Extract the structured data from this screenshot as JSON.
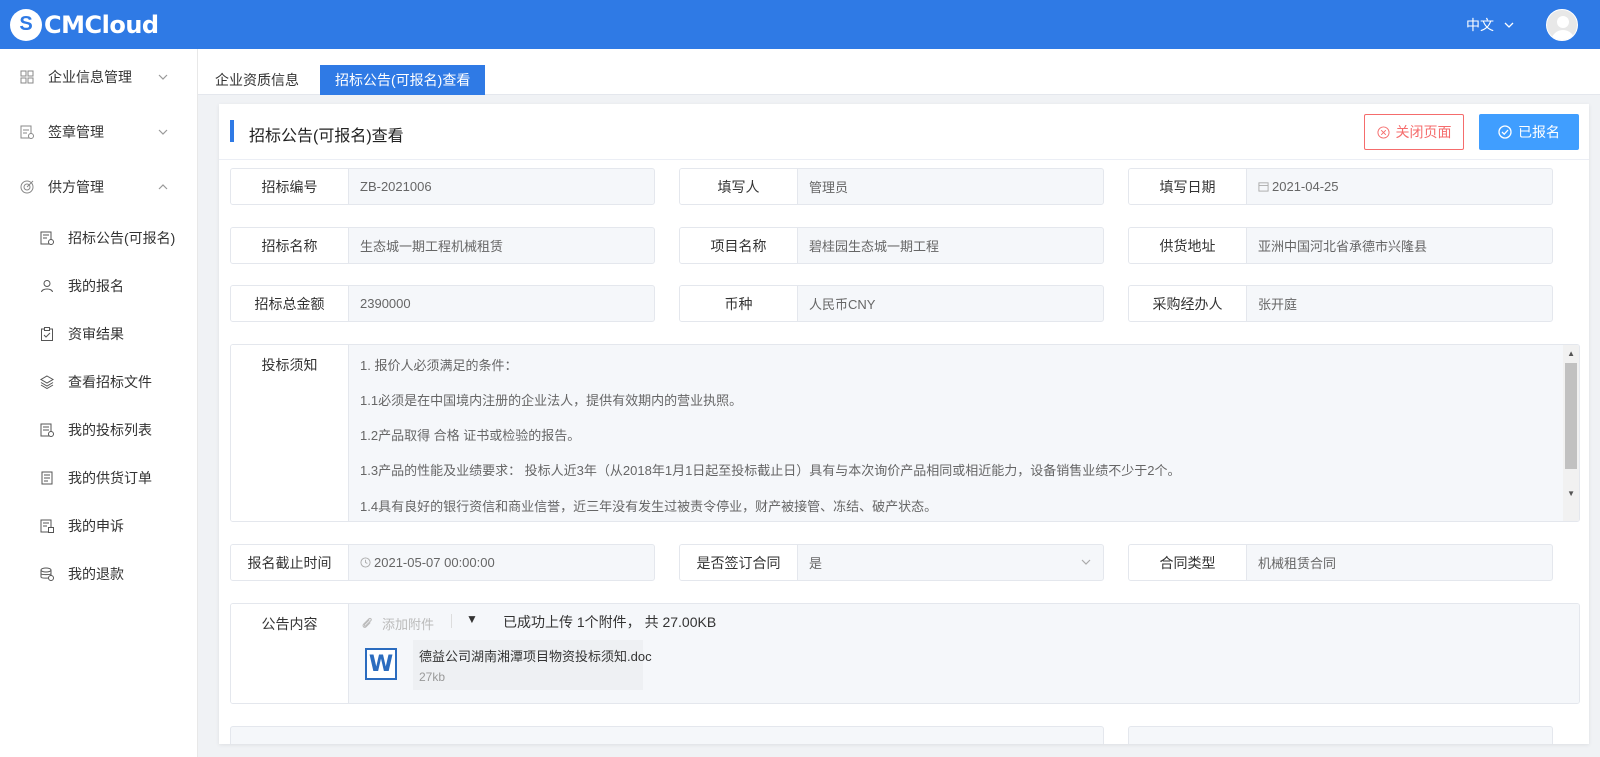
{
  "header": {
    "logo_mark": "S",
    "logo_text": "CMCloud",
    "language": "中文",
    "language_icon": "chevron-down-icon",
    "avatar_icon": "user-avatar-icon"
  },
  "sidebar": {
    "groups": [
      {
        "label": "企业信息管理",
        "icon": "grid-icon",
        "expanded": false
      },
      {
        "label": "签章管理",
        "icon": "stamp-icon",
        "expanded": false
      },
      {
        "label": "供方管理",
        "icon": "target-icon",
        "expanded": true
      }
    ],
    "sub_items": [
      {
        "label": "招标公告(可报名)",
        "icon": "document-icon"
      },
      {
        "label": "我的报名",
        "icon": "user-icon"
      },
      {
        "label": "资审结果",
        "icon": "clipboard-check-icon"
      },
      {
        "label": "查看招标文件",
        "icon": "layers-icon"
      },
      {
        "label": "我的投标列表",
        "icon": "file-list-icon"
      },
      {
        "label": "我的供货订单",
        "icon": "order-icon"
      },
      {
        "label": "我的申诉",
        "icon": "complaint-icon"
      },
      {
        "label": "我的退款",
        "icon": "refund-icon"
      }
    ]
  },
  "tabs": [
    {
      "label": "企业资质信息",
      "active": false
    },
    {
      "label": "招标公告(可报名)查看",
      "active": true
    }
  ],
  "card": {
    "title": "招标公告(可报名)查看",
    "close_button": "关闭页面",
    "registered_button": "已报名",
    "accent_color": "#2f7ae5"
  },
  "fields": {
    "bid_no": {
      "label": "招标编号",
      "value": "ZB-2021006"
    },
    "filler": {
      "label": "填写人",
      "value": "管理员"
    },
    "fill_date": {
      "label": "填写日期",
      "value": "2021-04-25"
    },
    "bid_name": {
      "label": "招标名称",
      "value": "生态城一期工程机械租赁"
    },
    "project_name": {
      "label": "项目名称",
      "value": "碧桂园生态城一期工程"
    },
    "supply_address": {
      "label": "供货地址",
      "value": "亚洲中国河北省承德市兴隆县"
    },
    "total_amount": {
      "label": "招标总金额",
      "value": "2390000"
    },
    "currency": {
      "label": "币种",
      "value": "人民币CNY"
    },
    "purchaser": {
      "label": "采购经办人",
      "value": "张开庭"
    },
    "deadline": {
      "label": "报名截止时间",
      "value": "2021-05-07 00:00:00"
    },
    "sign_contract": {
      "label": "是否签订合同",
      "value": "是"
    },
    "contract_type": {
      "label": "合同类型",
      "value": "机械租赁合同"
    }
  },
  "notice": {
    "label": "投标须知",
    "lines": [
      "1. 报价人必须满足的条件：",
      "1.1必须是在中国境内注册的企业法人，提供有效期内的营业执照。",
      "1.2产品取得 合格  证书或检验的报告。",
      "1.3产品的性能及业绩要求： 投标人近3年（从2018年1月1日起至投标截止日）具有与本次询价产品相同或相近能力，设备销售业绩不少于2个。",
      "1.4具有良好的银行资信和商业信誉，近三年没有发生过被责令停业，财产被接管、冻结、破产状态。"
    ]
  },
  "content": {
    "label": "公告内容",
    "attach_label": "添加附件",
    "upload_status": "已成功上传 1个附件， 共 27.00KB",
    "file": {
      "icon_letter": "W",
      "name": "德益公司湖南湘潭项目物资投标须知.doc",
      "size": "27kb"
    }
  }
}
